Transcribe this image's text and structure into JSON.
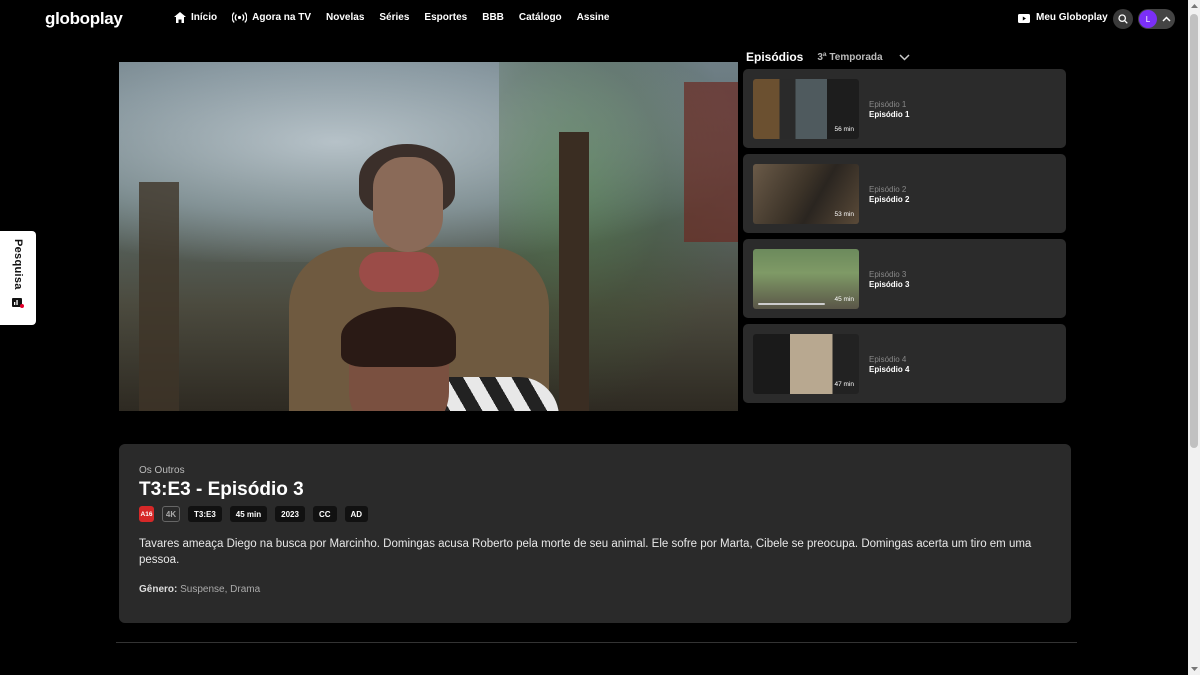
{
  "nav": {
    "logo": "globoplay",
    "links": [
      {
        "label": "Início",
        "icon": "home-icon"
      },
      {
        "label": "Agora na TV",
        "icon": "broadcast-icon"
      },
      {
        "label": "Novelas"
      },
      {
        "label": "Séries"
      },
      {
        "label": "Esportes"
      },
      {
        "label": "BBB"
      },
      {
        "label": "Catálogo"
      },
      {
        "label": "Assine"
      }
    ],
    "meu_globoplay": "Meu Globoplay",
    "avatar_initial": "L"
  },
  "side_tab": {
    "label": "Pesquisa"
  },
  "episodes": {
    "title": "Episódios",
    "season": "3ª Temporada",
    "items": [
      {
        "num": "Episódio 1",
        "name": "Episódio 1",
        "duration": "56 min"
      },
      {
        "num": "Episódio 2",
        "name": "Episódio 2",
        "duration": "53 min"
      },
      {
        "num": "Episódio 3",
        "name": "Episódio 3",
        "duration": "45 min",
        "progress": 0.7
      },
      {
        "num": "Episódio 4",
        "name": "Episódio 4",
        "duration": "47 min"
      }
    ]
  },
  "info": {
    "show_name": "Os Outros",
    "title": "T3:E3 - Episódio 3",
    "badges": {
      "age": "A16",
      "quality": "4K",
      "episode_code": "T3:E3",
      "duration": "45 min",
      "year": "2023",
      "cc": "CC",
      "ad": "AD"
    },
    "description": "Tavares ameaça Diego na busca por Marcinho. Domingas acusa Roberto pela morte de seu animal. Ele sofre por Marta, Cibele se preocupa. Domingas acerta um tiro em uma pessoa.",
    "genre_label": "Gênero:",
    "genre_value": "Suspense, Drama"
  },
  "colors": {
    "accent_avatar": "#7b2ff7",
    "age_badge": "#d62828",
    "card_bg": "#2a2a2a"
  }
}
